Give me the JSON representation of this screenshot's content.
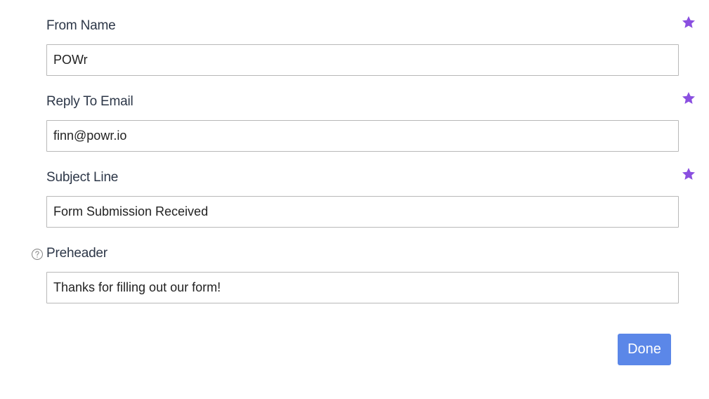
{
  "fields": [
    {
      "label": "From Name",
      "value": "POWr",
      "starred": true
    },
    {
      "label": "Reply To Email",
      "value": "finn@powr.io",
      "starred": true
    },
    {
      "label": "Subject Line",
      "value": "Form Submission Received",
      "starred": true
    },
    {
      "label": "Preheader",
      "value": "Thanks for filling out our form!",
      "starred": false,
      "help_icon": "question-circle-icon"
    }
  ],
  "actions": {
    "done_label": "Done"
  },
  "colors": {
    "star": "#8a4fe0",
    "done_button": "#5b87e8",
    "label_text": "#2d3748",
    "input_border": "#b8b8b8"
  }
}
